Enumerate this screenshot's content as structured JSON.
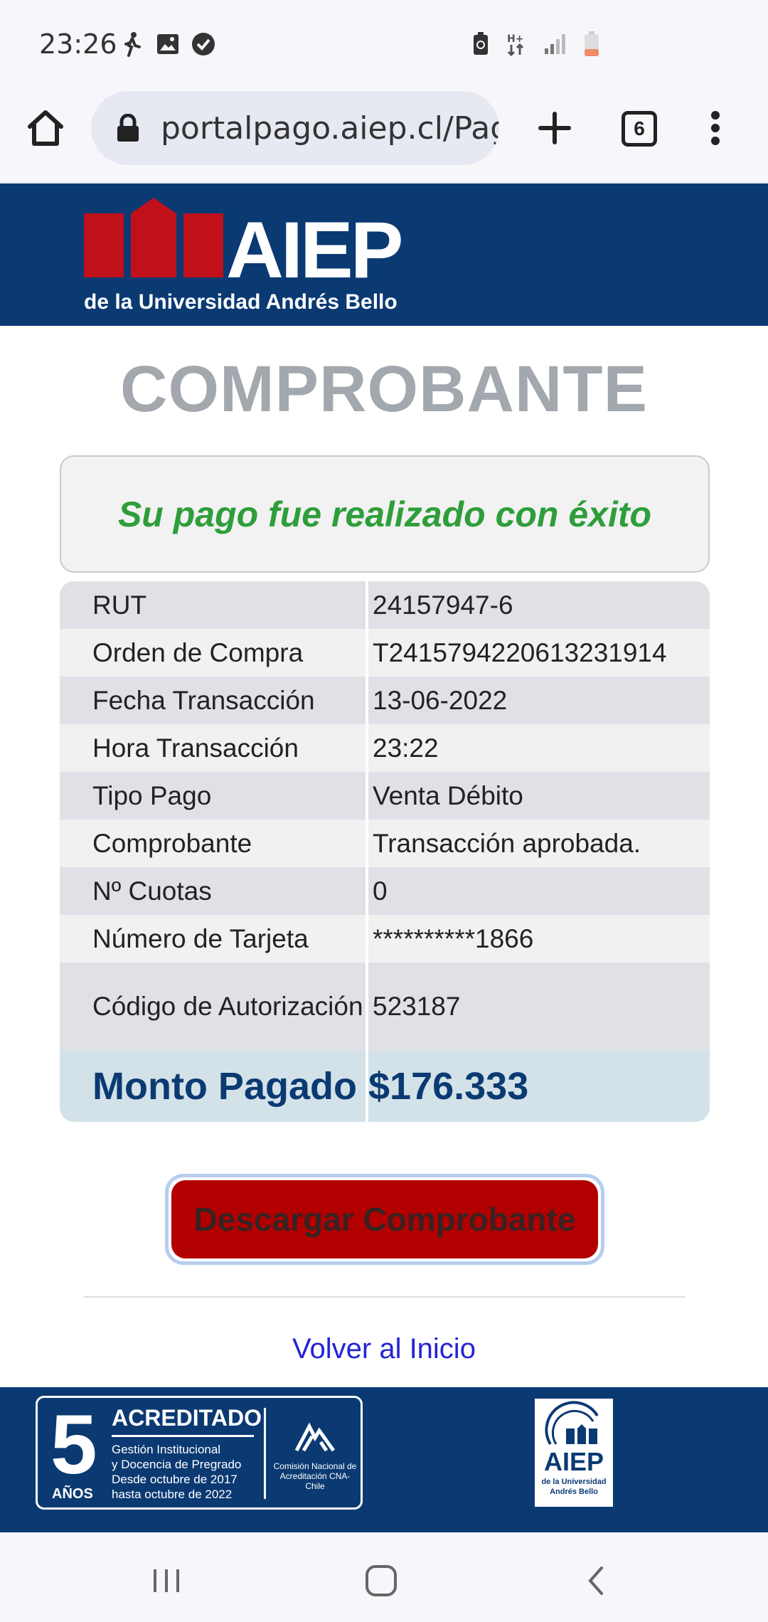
{
  "status_bar": {
    "time": "23:26",
    "left_icons": [
      "walk-icon",
      "image-icon",
      "check-shield-icon"
    ],
    "right_icons": [
      "battery-saver-icon",
      "data-icon",
      "signal-icon",
      "battery-low-icon"
    ]
  },
  "browser": {
    "url": "portalpago.aiep.cl/Pag",
    "tab_count": "6"
  },
  "header": {
    "logo_word": "AIEP",
    "logo_subtitle": "de la Universidad Andrés Bello",
    "brand_color": "#0b3a73",
    "logo_red": "#c0111a"
  },
  "page": {
    "title": "COMPROBANTE",
    "success_message": "Su pago fue realizado con éxito"
  },
  "receipt": {
    "rows": [
      {
        "label": "RUT",
        "value": "24157947-6"
      },
      {
        "label": "Orden de Compra",
        "value": "T2415794220613231914"
      },
      {
        "label": "Fecha Transacción",
        "value": "13-06-2022"
      },
      {
        "label": "Hora Transacción",
        "value": "23:22"
      },
      {
        "label": "Tipo Pago",
        "value": "Venta Débito"
      },
      {
        "label": "Comprobante",
        "value": "Transacción aprobada."
      },
      {
        "label": "Nº Cuotas",
        "value": "0"
      },
      {
        "label": "Número de Tarjeta",
        "value": "**********1866"
      },
      {
        "label": "Código de Autorización",
        "value": "523187"
      }
    ],
    "total_label": "Monto Pagado",
    "total_value": "$176.333"
  },
  "actions": {
    "download_label": "Descargar Comprobante",
    "home_link": "Volver al Inicio"
  },
  "footer": {
    "accred_number": "5",
    "accred_years": "AÑOS",
    "accred_title": "ACREDITADO",
    "accred_lines": [
      "Gestión Institucional",
      "y Docencia de Pregrado",
      "Desde octubre de 2017",
      "hasta octubre de 2022"
    ],
    "cna_text": "Comisión Nacional de Acreditación CNA-Chile",
    "logo_word": "AIEP",
    "logo_sub": "de la Universidad Andrés Bello"
  }
}
